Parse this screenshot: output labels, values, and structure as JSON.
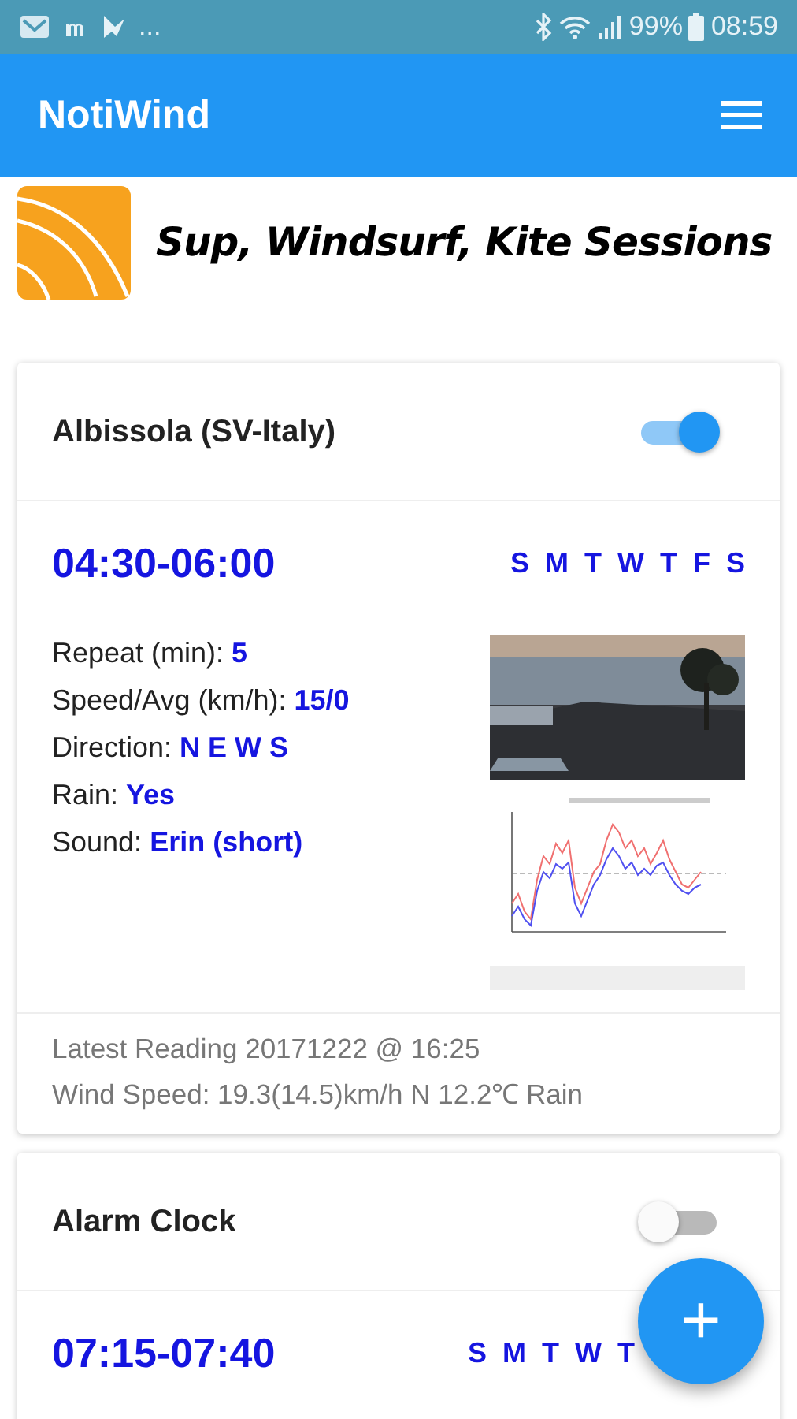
{
  "status_bar": {
    "more": "...",
    "battery": "99%",
    "time": "08:59"
  },
  "app_bar": {
    "title": "NotiWind"
  },
  "banner": {
    "tagline": "Sup, Windsurf, Kite Sessions"
  },
  "alarms": [
    {
      "name": "Albissola (SV-Italy)",
      "on": true,
      "time": "04:30-06:00",
      "days": [
        "S",
        "M",
        "T",
        "W",
        "T",
        "F",
        "S"
      ],
      "details": [
        {
          "label": "Repeat (min):",
          "value": "5"
        },
        {
          "label": "Speed/Avg (km/h):",
          "value": "15/0"
        },
        {
          "label": "Direction:",
          "value": "N E W S"
        },
        {
          "label": "Rain:",
          "value": "Yes"
        },
        {
          "label": "Sound:",
          "value": "Erin (short)"
        }
      ],
      "footer": [
        "Latest Reading 20171222 @ 16:25",
        "Wind Speed: 19.3(14.5)km/h N 12.2℃ Rain"
      ]
    },
    {
      "name": "Alarm Clock",
      "on": false,
      "time": "07:15-07:40",
      "days": [
        "S",
        "M",
        "T",
        "W",
        "T"
      ]
    }
  ],
  "fab": {
    "label": "+"
  }
}
